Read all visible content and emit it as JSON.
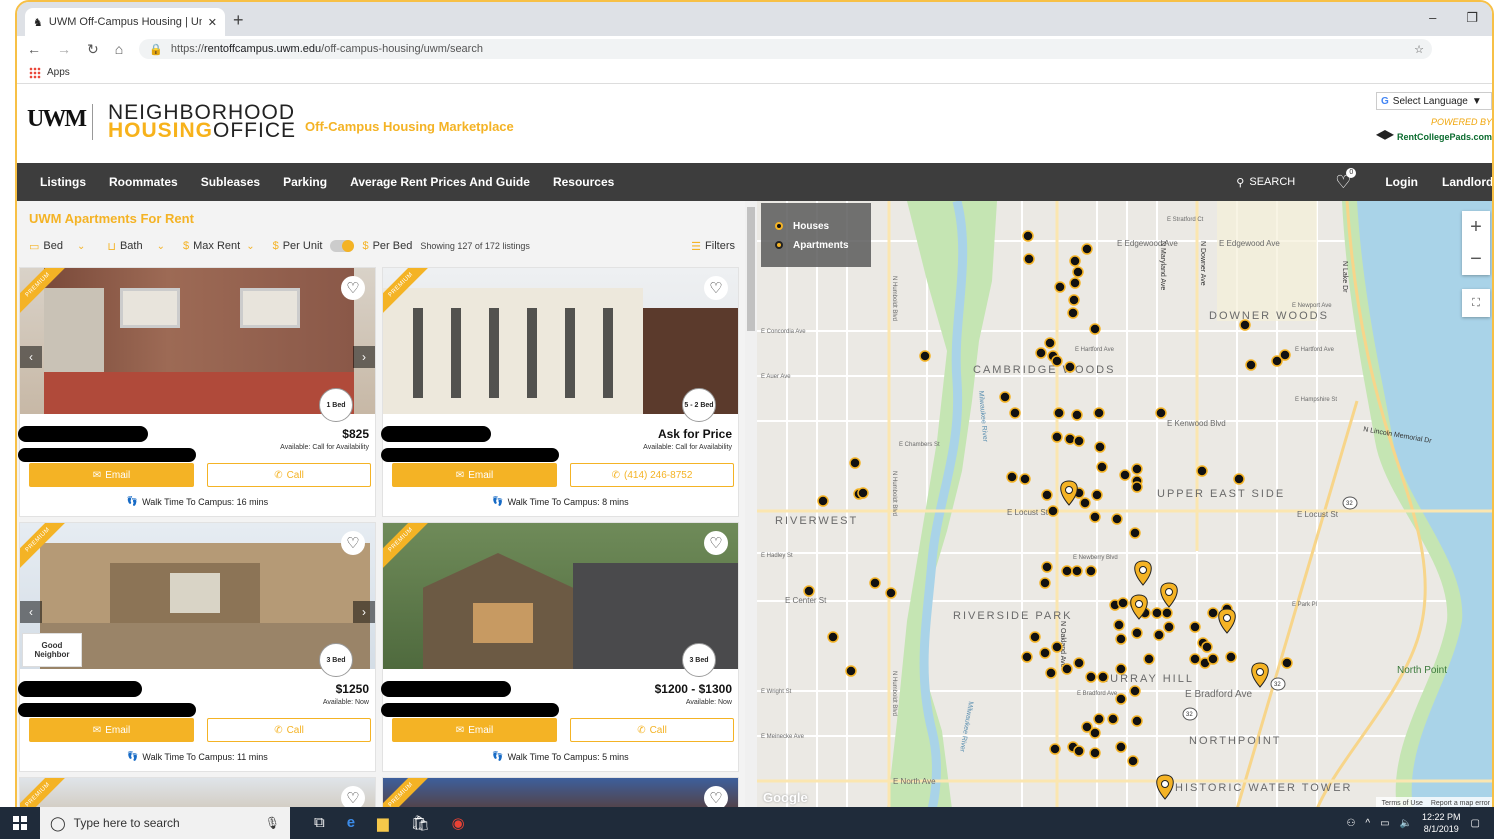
{
  "browser": {
    "tab_title": "UWM Off-Campus Housing | Uni",
    "url_prefix": "https://",
    "url_host": "rentoffcampus.uwm.edu",
    "url_path": "/off-campus-housing/uwm/search",
    "bookmarks_apps": "Apps"
  },
  "site": {
    "logo_uwm": "UWM",
    "logo_line1": "NEIGHBORHOOD",
    "logo_line2a": "HOUSING",
    "logo_line2b": "OFFICE",
    "marketplace_title": "Off-Campus Housing Marketplace",
    "select_language": "Select Language",
    "powered_by": "POWERED BY",
    "rcp_brand": "RentCollegePads.com"
  },
  "nav": {
    "items": [
      "Listings",
      "Roommates",
      "Subleases",
      "Parking",
      "Average Rent Prices And Guide",
      "Resources"
    ],
    "search": "SEARCH",
    "fav_count": "0",
    "login": "Login",
    "landlords": "Landlords"
  },
  "listings": {
    "heading": "UWM Apartments For Rent",
    "filters": {
      "bed": "Bed",
      "bath": "Bath",
      "max_rent": "Max Rent",
      "per_unit": "Per Unit",
      "per_bed": "Per Bed",
      "showing": "Showing 127 of 172 listings",
      "filters_btn": "Filters"
    },
    "cards": [
      {
        "badge": "1 Bed",
        "price": "$825",
        "avail": "Available: Call for Availability",
        "email": "Email",
        "call": "Call",
        "walk": "Walk Time To Campus: 16 mins",
        "ribbon": "PREMIUM"
      },
      {
        "badge": "5 - 2 Bed",
        "price": "Ask for Price",
        "avail": "Available: Call for Availability",
        "email": "Email",
        "call": "(414) 246-8752",
        "walk": "Walk Time To Campus: 8 mins",
        "ribbon": "PREMIUM"
      },
      {
        "badge": "3 Bed",
        "price": "$1250",
        "avail": "Available: Now",
        "email": "Email",
        "call": "Call",
        "walk": "Walk Time To Campus: 11 mins",
        "ribbon": "PREMIUM",
        "sticker": "Good Neighbor"
      },
      {
        "badge": "3 Bed",
        "price": "$1200 - $1300",
        "avail": "Available: Now",
        "email": "Email",
        "call": "Call",
        "walk": "Walk Time To Campus: 5 mins",
        "ribbon": "PREMIUM"
      }
    ],
    "next_ribbons": [
      "PREMIUM",
      "PREMIUM"
    ]
  },
  "map": {
    "legend_houses": "Houses",
    "legend_apartments": "Apartments",
    "labels": {
      "downer_woods": "DOWNER WOODS",
      "cambridge_woods": "CAMBRIDGE WOODS",
      "riverwest": "RIVERWEST",
      "upper_east_side": "UPPER EAST SIDE",
      "riverside_park": "RIVERSIDE PARK",
      "murray_hill": "MURRAY HILL",
      "northpoint": "NORTHPOINT",
      "historic_water_tower": "HISTORIC WATER TOWER",
      "north_point": "North Point",
      "edgewood": "E Edgewood Ave",
      "edgewood2": "E Edgewood Ave",
      "locust": "E Locust St",
      "locust2": "E Locust St",
      "kenwood": "E Kenwood Blvd",
      "hartford": "E Hartford Ave",
      "hartford2": "E Hartford Ave",
      "newport": "E Newport Ave",
      "hampshire": "E Hampshire St",
      "newberry": "E Newberry Blvd",
      "center": "E Center St",
      "park_pl": "E Park Pl",
      "bradford": "E Bradford Ave",
      "bradford_small": "E Bradford Ave",
      "wright": "E Wright St",
      "meinecke": "E Meinecke Ave",
      "north_ave": "E North Ave",
      "chambers": "E Chambers St",
      "hadley": "E Hadley St",
      "auer": "E Auer Ave",
      "concordia": "E Concordia Ave",
      "stratford": "E Stratford Ct",
      "lincoln_memorial": "N Lincoln Memorial Dr",
      "humboldt": "N Humboldt Blvd",
      "humboldt2": "N Humboldt Blvd",
      "humboldt3": "N Humboldt Blvd",
      "oakland": "N Oakland Ave",
      "downer": "N Downer Ave",
      "maryland": "N Maryland Ave",
      "lake_dr": "N Lake Dr",
      "river": "Milwaukee River",
      "river2": "Milwaukee River",
      "route32": "32",
      "route32b": "32",
      "route32c": "32"
    },
    "google": "Google",
    "terms": "Terms of Use",
    "report": "Report a map error",
    "colors": {
      "house_dot": "#111111",
      "dot_border": "#f4b325",
      "park": "#c5e5b3",
      "water": "#a9d3e8"
    }
  },
  "taskbar": {
    "search_placeholder": "Type here to search",
    "time": "12:22 PM",
    "date": "8/1/2019"
  }
}
